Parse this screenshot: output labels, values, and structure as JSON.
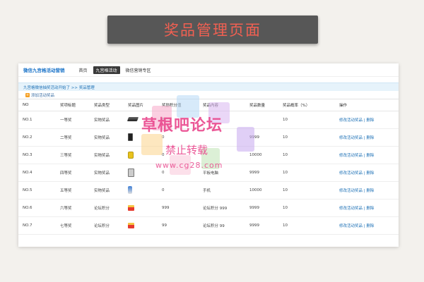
{
  "banner": {
    "title": "奖品管理页面"
  },
  "topnav": {
    "brand": "微信九宫格活动营销",
    "items": [
      {
        "label": "首页",
        "active": false
      },
      {
        "label": "九宫格活动",
        "active": true
      },
      {
        "label": "微信营销专区",
        "active": false
      }
    ]
  },
  "breadcrumb": "九宫格微信抽奖活动开始了 >> 奖品管理",
  "add_button": "添加活动奖品",
  "table": {
    "headers": [
      "NO",
      "奖项标题",
      "奖品类型",
      "奖品图片",
      "奖励积分值",
      "奖品内容",
      "奖品数量",
      "奖品概率（%）",
      "操作"
    ],
    "rows": [
      {
        "no": "NO.1",
        "title": "一等奖",
        "type": "实物奖品",
        "icon": "laptop-icon",
        "points": "0",
        "content": "",
        "qty": "",
        "prob": "10",
        "edit": "修改活动奖品",
        "sep": "|",
        "del": "删除"
      },
      {
        "no": "NO.2",
        "title": "二等奖",
        "type": "实物奖品",
        "icon": "phone-icon",
        "points": "0",
        "content": "",
        "qty": "9999",
        "prob": "10",
        "edit": "修改活动奖品",
        "sep": "|",
        "del": "删除"
      },
      {
        "no": "NO.3",
        "title": "三等奖",
        "type": "实物奖品",
        "icon": "watch-icon",
        "points": "0",
        "content": "",
        "qty": "10000",
        "prob": "10",
        "edit": "修改活动奖品",
        "sep": "|",
        "del": "删除"
      },
      {
        "no": "NO.4",
        "title": "四等奖",
        "type": "实物奖品",
        "icon": "tablet-icon",
        "points": "0",
        "content": "平板电脑",
        "qty": "9999",
        "prob": "10",
        "edit": "修改活动奖品",
        "sep": "|",
        "del": "删除"
      },
      {
        "no": "NO.5",
        "title": "五等奖",
        "type": "实物奖品",
        "icon": "figure-icon",
        "points": "0",
        "content": "手机",
        "qty": "10000",
        "prob": "10",
        "edit": "修改活动奖品",
        "sep": "|",
        "del": "删除"
      },
      {
        "no": "NO.6",
        "title": "六等奖",
        "type": "论坛积分",
        "icon": "envelope-icon",
        "points": "999",
        "content": "论坛积分 999",
        "qty": "9999",
        "prob": "10",
        "edit": "修改活动奖品",
        "sep": "|",
        "del": "删除"
      },
      {
        "no": "NO.7",
        "title": "七等奖",
        "type": "论坛积分",
        "icon": "envelope-icon",
        "points": "99",
        "content": "论坛积分 99",
        "qty": "9999",
        "prob": "10",
        "edit": "修改活动奖品",
        "sep": "|",
        "del": "删除"
      }
    ]
  },
  "watermark": {
    "title": "草根吧论坛",
    "sub": "禁止转载",
    "url": "www.cg28.com"
  },
  "colors": {
    "banner_bg": "#575757",
    "banner_text": "#f26052",
    "link": "#1a6fb5",
    "watermark": "#e9468c"
  }
}
